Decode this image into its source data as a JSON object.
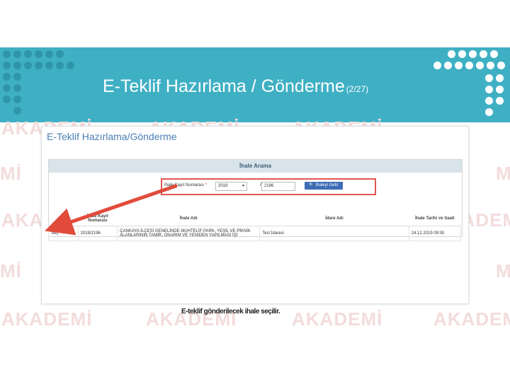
{
  "slide": {
    "title": "E-Teklif Hazırlama /  Gönderme",
    "page": "(2/27)",
    "caption": "E-teklif gönderilecek ihale seçilir."
  },
  "watermark": {
    "text": "AKADEMİ",
    "small": "Mİ"
  },
  "screen": {
    "title": "E-Teklif Hazırlama/Gönderme",
    "badge": "?",
    "panel_title": "İhale Arama",
    "search": {
      "label": "İhale Kayıt Numarası",
      "required_mark": "*",
      "year": "2019",
      "separator": "/",
      "number": "2196",
      "button": "İhaleyi Getir"
    },
    "table": {
      "headers": [
        "",
        "İhale Kayıt Numarası",
        "İhale Adı",
        "İdare Adı",
        "İhale Tarihi ve Saati"
      ],
      "rows": [
        {
          "action": "Seç",
          "ikn": "2019/2196",
          "name": "ÇANKAYA İLÇESİ GENELİNDE MUHTELİF PARK, YEŞİL VE PİKNİK ALANLARININ TAMİR, ONARIM VE YENİDEN YAPILMASI İŞİ",
          "admin": "Test İdaresi",
          "date": "24.12.2019 09:00"
        }
      ]
    }
  },
  "colors": {
    "banner": "#3fb0c4",
    "highlight": "#e05555",
    "button": "#3d6cb7"
  }
}
